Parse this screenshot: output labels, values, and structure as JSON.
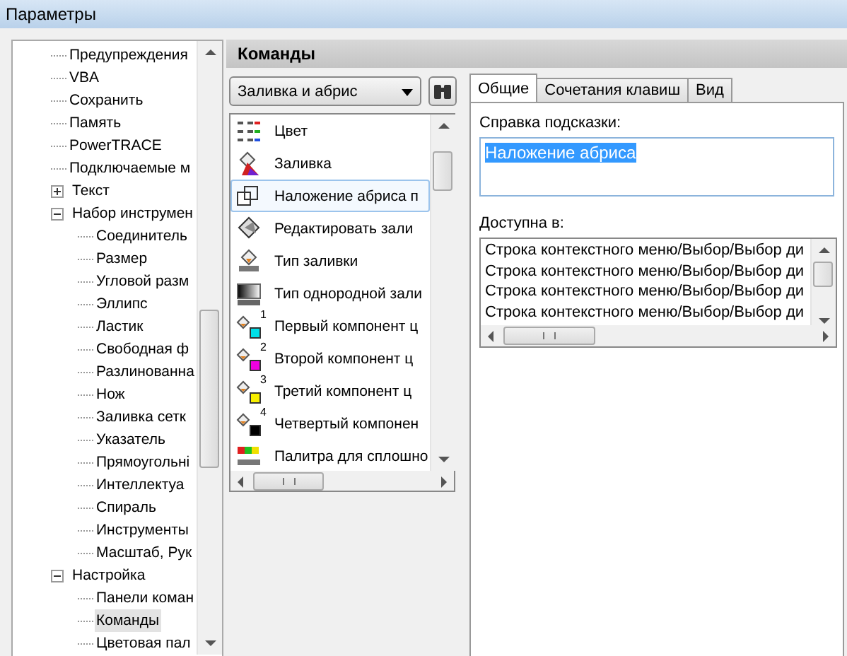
{
  "window": {
    "title": "Параметры"
  },
  "tree": [
    {
      "label": "Предупреждения",
      "selected": false
    },
    {
      "label": "VBA",
      "selected": false
    },
    {
      "label": "Сохранить",
      "selected": false
    },
    {
      "label": "Память",
      "selected": false
    },
    {
      "label": "PowerTRACE",
      "selected": false
    },
    {
      "label": "Подключаемые м",
      "selected": false
    },
    {
      "label": "Текст",
      "selected": false,
      "expanded": false
    },
    {
      "label": "Набор инструмен",
      "selected": false,
      "expanded": true,
      "children": [
        {
          "label": "Соединитель",
          "selected": false
        },
        {
          "label": "Размер",
          "selected": false
        },
        {
          "label": "Угловой разм",
          "selected": false
        },
        {
          "label": "Эллипс",
          "selected": false
        },
        {
          "label": "Ластик",
          "selected": false
        },
        {
          "label": "Свободная ф",
          "selected": false
        },
        {
          "label": "Разлинованна",
          "selected": false
        },
        {
          "label": "Нож",
          "selected": false
        },
        {
          "label": "Заливка сетк",
          "selected": false
        },
        {
          "label": "Указатель",
          "selected": false
        },
        {
          "label": "Прямоугольні",
          "selected": false
        },
        {
          "label": "Интеллектуа",
          "selected": false
        },
        {
          "label": "Спираль",
          "selected": false
        },
        {
          "label": "Инструменты",
          "selected": false
        },
        {
          "label": "Масштаб, Рук",
          "selected": false
        }
      ]
    },
    {
      "label": "Настройка",
      "selected": false,
      "expanded": true,
      "children": [
        {
          "label": "Панели коман",
          "selected": false
        },
        {
          "label": "Команды",
          "selected": true
        },
        {
          "label": "Цветовая пал",
          "selected": false
        }
      ]
    }
  ],
  "section": {
    "title": "Команды"
  },
  "category": {
    "value": "Заливка и абрис"
  },
  "commands": [
    {
      "label": "Цвет",
      "kind": "color",
      "selected": false
    },
    {
      "label": "Заливка",
      "kind": "fill",
      "selected": false
    },
    {
      "label": "Наложение абриса п",
      "kind": "overlay",
      "selected": true
    },
    {
      "label": "Редактировать зали",
      "kind": "edit",
      "selected": false
    },
    {
      "label": "Тип заливки",
      "kind": "filltype",
      "selected": false
    },
    {
      "label": "Тип однородной зали",
      "kind": "uniform",
      "selected": false
    },
    {
      "label": "Первый компонент ц",
      "kind": "component",
      "badge": "1",
      "color": "#00e0e8",
      "selected": false
    },
    {
      "label": "Второй компонент ц",
      "kind": "component",
      "badge": "2",
      "color": "#f000e0",
      "selected": false
    },
    {
      "label": "Третий компонент ц",
      "kind": "component",
      "badge": "3",
      "color": "#f8f000",
      "selected": false
    },
    {
      "label": "Четвертый компонен",
      "kind": "component",
      "badge": "4",
      "color": "#000000",
      "selected": false
    },
    {
      "label": "Палитра для сплошно",
      "kind": "palette",
      "selected": false
    }
  ],
  "tabs": [
    {
      "label": "Общие",
      "selected": true
    },
    {
      "label": "Сочетания клавиш",
      "selected": false
    },
    {
      "label": "Вид",
      "selected": false
    }
  ],
  "tooltip_help": {
    "label": "Справка подсказки:",
    "value": "Наложение абриса"
  },
  "available_in": {
    "label": "Доступна в:",
    "items": [
      "Строка контекстного меню/Выбор/Выбор ди",
      "Строка контекстного меню/Выбор/Выбор ди",
      "Строка контекстного меню/Выбор/Выбор ди",
      "Строка контекстного меню/Выбор/Выбор ди"
    ]
  }
}
